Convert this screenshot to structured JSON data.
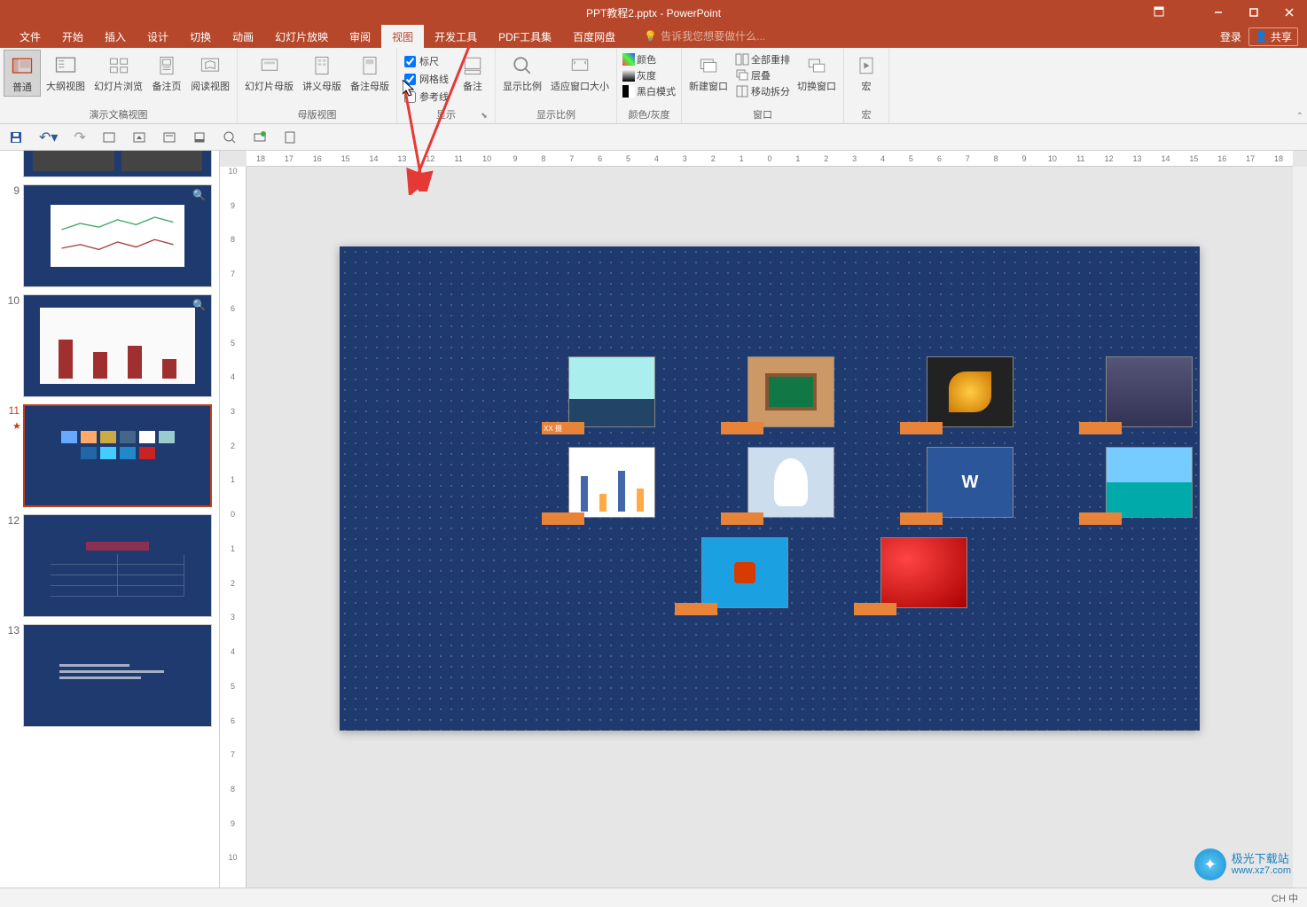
{
  "title": "PPT教程2.pptx - PowerPoint",
  "tabs": {
    "file": "文件",
    "home": "开始",
    "insert": "插入",
    "design": "设计",
    "transitions": "切换",
    "animations": "动画",
    "slideshow": "幻灯片放映",
    "review": "审阅",
    "view": "视图",
    "developer": "开发工具",
    "pdf": "PDF工具集",
    "baidu": "百度网盘"
  },
  "tell_me_placeholder": "告诉我您想要做什么...",
  "login": "登录",
  "share": "共享",
  "ribbon": {
    "presentation_views": {
      "normal": "普通",
      "outline": "大纲视图",
      "sorter": "幻灯片浏览",
      "notes": "备注页",
      "reading": "阅读视图",
      "label": "演示文稿视图"
    },
    "master_views": {
      "slide_master": "幻灯片母版",
      "handout_master": "讲义母版",
      "notes_master": "备注母版",
      "label": "母版视图"
    },
    "show": {
      "ruler": "标尺",
      "gridlines": "网格线",
      "guides": "参考线",
      "notes_btn": "备注",
      "label": "显示"
    },
    "zoom": {
      "zoom": "显示比例",
      "fit": "适应窗口大小",
      "label": "显示比例"
    },
    "color": {
      "color": "颜色",
      "gray": "灰度",
      "bw": "黑白模式",
      "label": "颜色/灰度"
    },
    "window": {
      "new": "新建窗口",
      "arrange": "全部重排",
      "cascade": "层叠",
      "split": "移动拆分",
      "switch": "切换窗口",
      "label": "窗口"
    },
    "macros": {
      "macros": "宏",
      "label": "宏"
    }
  },
  "slides": [
    {
      "num": "9"
    },
    {
      "num": "10"
    },
    {
      "num": "11",
      "selected": true
    },
    {
      "num": "12"
    },
    {
      "num": "13"
    }
  ],
  "slide_partial_num": "",
  "ruler_h": [
    "18",
    "17",
    "16",
    "15",
    "14",
    "13",
    "12",
    "11",
    "10",
    "9",
    "8",
    "7",
    "6",
    "5",
    "4",
    "3",
    "2",
    "1",
    "0",
    "1",
    "2",
    "3",
    "4",
    "5",
    "6",
    "7",
    "8",
    "9",
    "10",
    "11",
    "12",
    "13",
    "14",
    "15",
    "16",
    "17",
    "18"
  ],
  "ruler_v": [
    "10",
    "9",
    "8",
    "7",
    "6",
    "5",
    "4",
    "3",
    "2",
    "1",
    "0",
    "1",
    "2",
    "3",
    "4",
    "5",
    "6",
    "7",
    "8",
    "9",
    "10"
  ],
  "img_labels": [
    "XX 摄",
    "",
    "",
    "",
    "",
    "",
    "",
    "",
    "",
    ""
  ],
  "watermark": {
    "site": "极光下载站",
    "url": "www.xz7.com"
  },
  "ime_status": "CH 中"
}
